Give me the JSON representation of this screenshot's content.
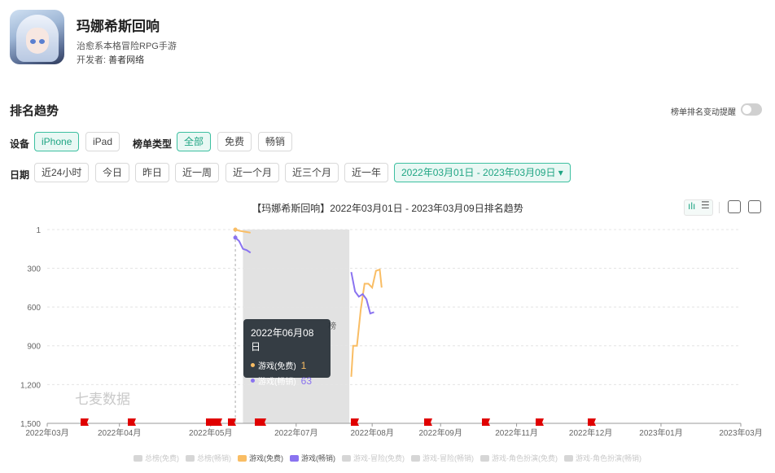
{
  "app": {
    "name": "玛娜希斯回响",
    "subtitle": "治愈系本格冒险RPG手游",
    "developer_label": "开发者:",
    "developer": "善者网络"
  },
  "section": {
    "title": "排名趋势",
    "remind_label": "榜单排名变动提醒"
  },
  "filters": {
    "device_label": "设备",
    "devices": [
      "iPhone",
      "iPad"
    ],
    "device_selected": "iPhone",
    "chart_type_label": "榜单类型",
    "chart_types": [
      "全部",
      "免费",
      "畅销"
    ],
    "chart_type_selected": "全部",
    "date_label": "日期",
    "dates": [
      "近24小时",
      "今日",
      "昨日",
      "近一周",
      "近一个月",
      "近三个月",
      "近一年"
    ],
    "date_range": "2022年03月01日 - 2023年03月09日"
  },
  "chart_data": {
    "type": "line",
    "title": "【玛娜希斯回响】2022年03月01日 - 2023年03月09日排名趋势",
    "y_axis": {
      "ticks": [
        "1",
        "300",
        "600",
        "900",
        "1,200",
        "1,500"
      ],
      "range": [
        1,
        1500
      ],
      "inverted": true
    },
    "x_axis": {
      "ticks": [
        "2022年03月",
        "2022年04月",
        "2022年05月",
        "2022年07月",
        "2022年08月",
        "2022年09月",
        "2022年11月",
        "2022年12月",
        "2023年01月",
        "2023年03月"
      ]
    },
    "shaded_region": {
      "from": "2022-06-12",
      "to": "2022-08-07",
      "label": "榜"
    },
    "series": [
      {
        "name": "游戏(免费)",
        "color": "#f9bd64",
        "x": [
          "2022-06-08",
          "2022-06-10",
          "2022-06-12",
          "2022-06-14",
          "2022-06-16",
          "2022-08-08",
          "2022-08-09",
          "2022-08-11",
          "2022-08-13",
          "2022-08-15",
          "2022-08-17",
          "2022-08-19",
          "2022-08-21",
          "2022-08-23",
          "2022-08-24"
        ],
        "y": [
          1,
          10,
          15,
          20,
          25,
          1140,
          900,
          900,
          620,
          420,
          420,
          450,
          320,
          310,
          450
        ]
      },
      {
        "name": "游戏(畅销)",
        "color": "#8a73f0",
        "x": [
          "2022-06-08",
          "2022-06-10",
          "2022-06-12",
          "2022-06-14",
          "2022-06-16",
          "2022-08-08",
          "2022-08-10",
          "2022-08-12",
          "2022-08-14",
          "2022-08-16",
          "2022-08-18",
          "2022-08-20"
        ],
        "y": [
          63,
          90,
          150,
          160,
          180,
          330,
          480,
          520,
          500,
          540,
          650,
          640
        ]
      }
    ],
    "events_count": 14,
    "legend": [
      "总榜(免费)",
      "总榜(畅销)",
      "游戏(免费)",
      "游戏(畅销)",
      "游戏-冒险(免费)",
      "游戏-冒险(畅销)",
      "游戏-角色扮演(免费)",
      "游戏-角色扮演(畅销)"
    ],
    "legend_active": [
      "游戏(免费)",
      "游戏(畅销)"
    ],
    "watermark": "七麦数据"
  },
  "tooltip": {
    "date": "2022年06月08日",
    "rows": [
      {
        "label": "游戏(免费)",
        "value": "1",
        "color": "#f9bd64"
      },
      {
        "label": "游戏(畅销)",
        "value": "63",
        "color": "#8a73f0"
      }
    ]
  }
}
